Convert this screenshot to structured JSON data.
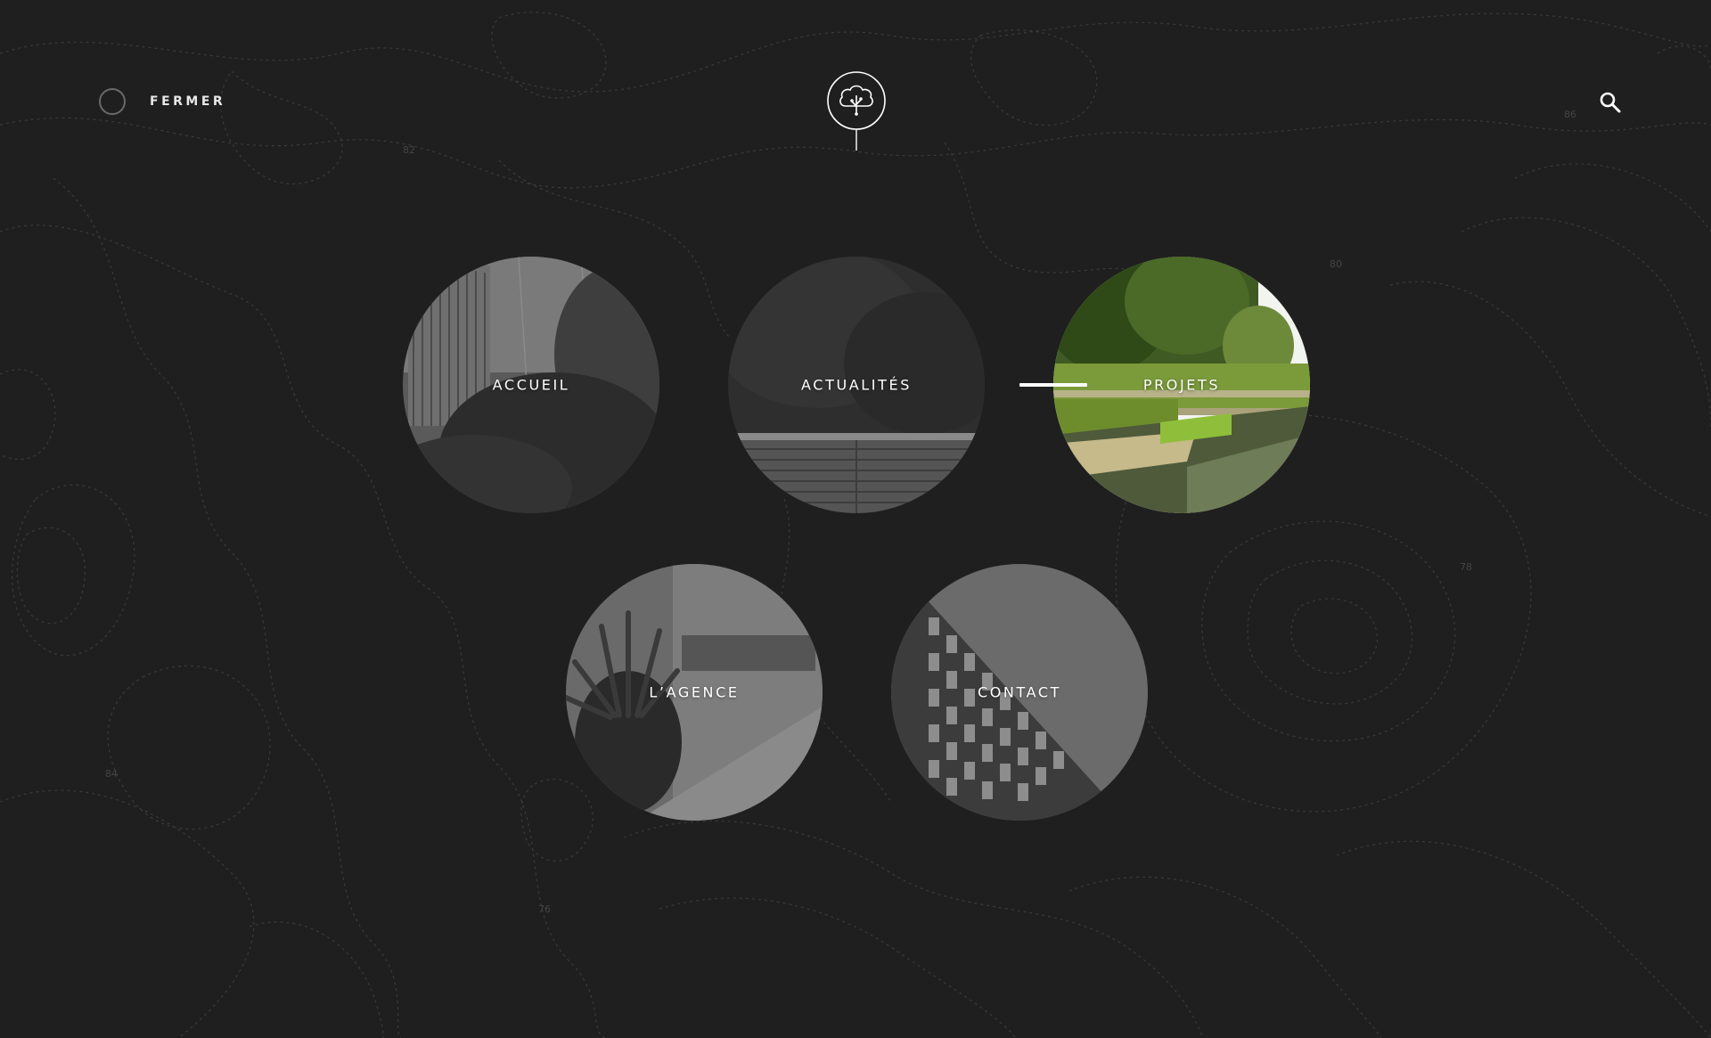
{
  "header": {
    "close_label": "FERMER",
    "logo_icon": "tree-cloud-icon",
    "search_icon": "search-icon"
  },
  "menu": {
    "active": "projets",
    "items": [
      {
        "id": "accueil",
        "label": "ACCUEIL",
        "photo": "grayscale wooden hut among trees"
      },
      {
        "id": "actualites",
        "label": "ACTUALITÉS",
        "photo": "grayscale building with wooden facade"
      },
      {
        "id": "projets",
        "label": "PROJETS",
        "photo": "color landscape with trees, lawn terraces and water"
      },
      {
        "id": "agence",
        "label": "L’AGENCE",
        "photo": "grayscale potted succulent on table"
      },
      {
        "id": "contact",
        "label": "CONTACT",
        "photo": "grayscale office building facade"
      }
    ]
  },
  "colors": {
    "background": "#1f1f1f",
    "contour": "#3a3a3a",
    "text": "#ffffff"
  }
}
